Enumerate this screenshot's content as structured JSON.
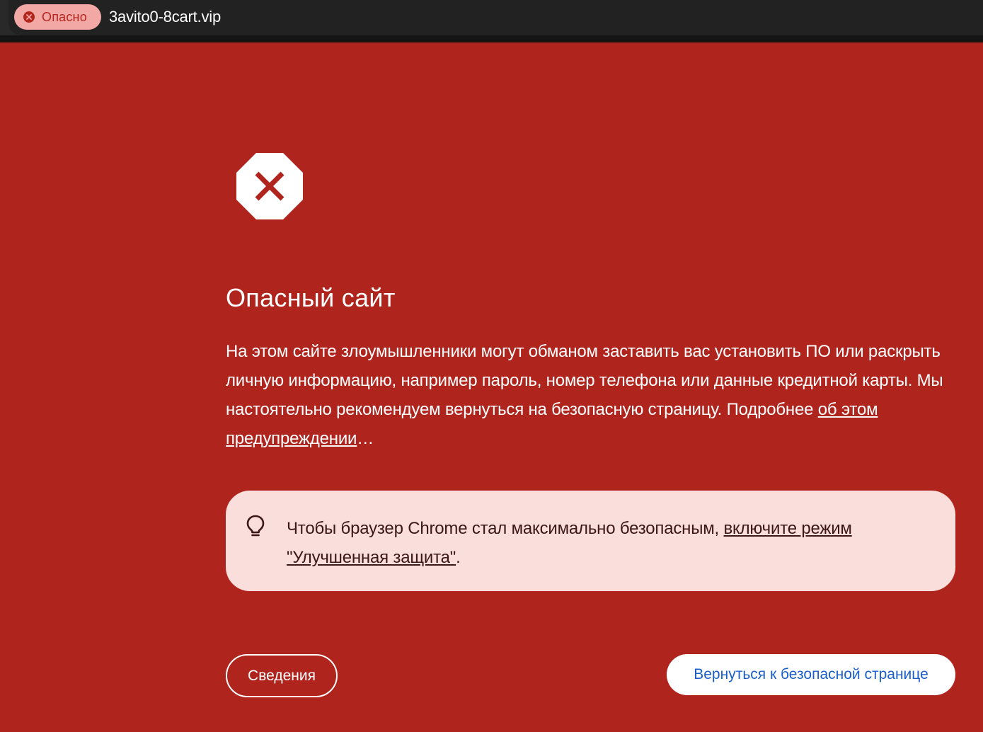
{
  "browser": {
    "security_chip_label": "Опасно",
    "url": "3avito0-8cart.vip"
  },
  "interstitial": {
    "icon": "stop-x-icon",
    "title": "Опасный сайт",
    "body_main": "На этом сайте злоумышленники могут обманом заставить вас установить ПО или раскрыть личную информацию, например пароль, номер телефона или данные кредитной карты. Мы настоятельно рекомендуем вернуться на безопасную страницу. Подробнее ",
    "body_link": "об этом предупреждении",
    "body_suffix": "…",
    "tip": {
      "icon": "lightbulb-icon",
      "text": "Чтобы браузер Chrome стал максимально безопасным, ",
      "link": "включите режим \"Улучшенная защита\"",
      "suffix": "."
    },
    "details_button": "Сведения",
    "back_button": "Вернуться к безопасной странице"
  },
  "colors": {
    "background": "#b0241e",
    "tip_background": "#fadedc",
    "chip_background": "#f2a9a6",
    "back_button_text": "#1a5fc9"
  }
}
